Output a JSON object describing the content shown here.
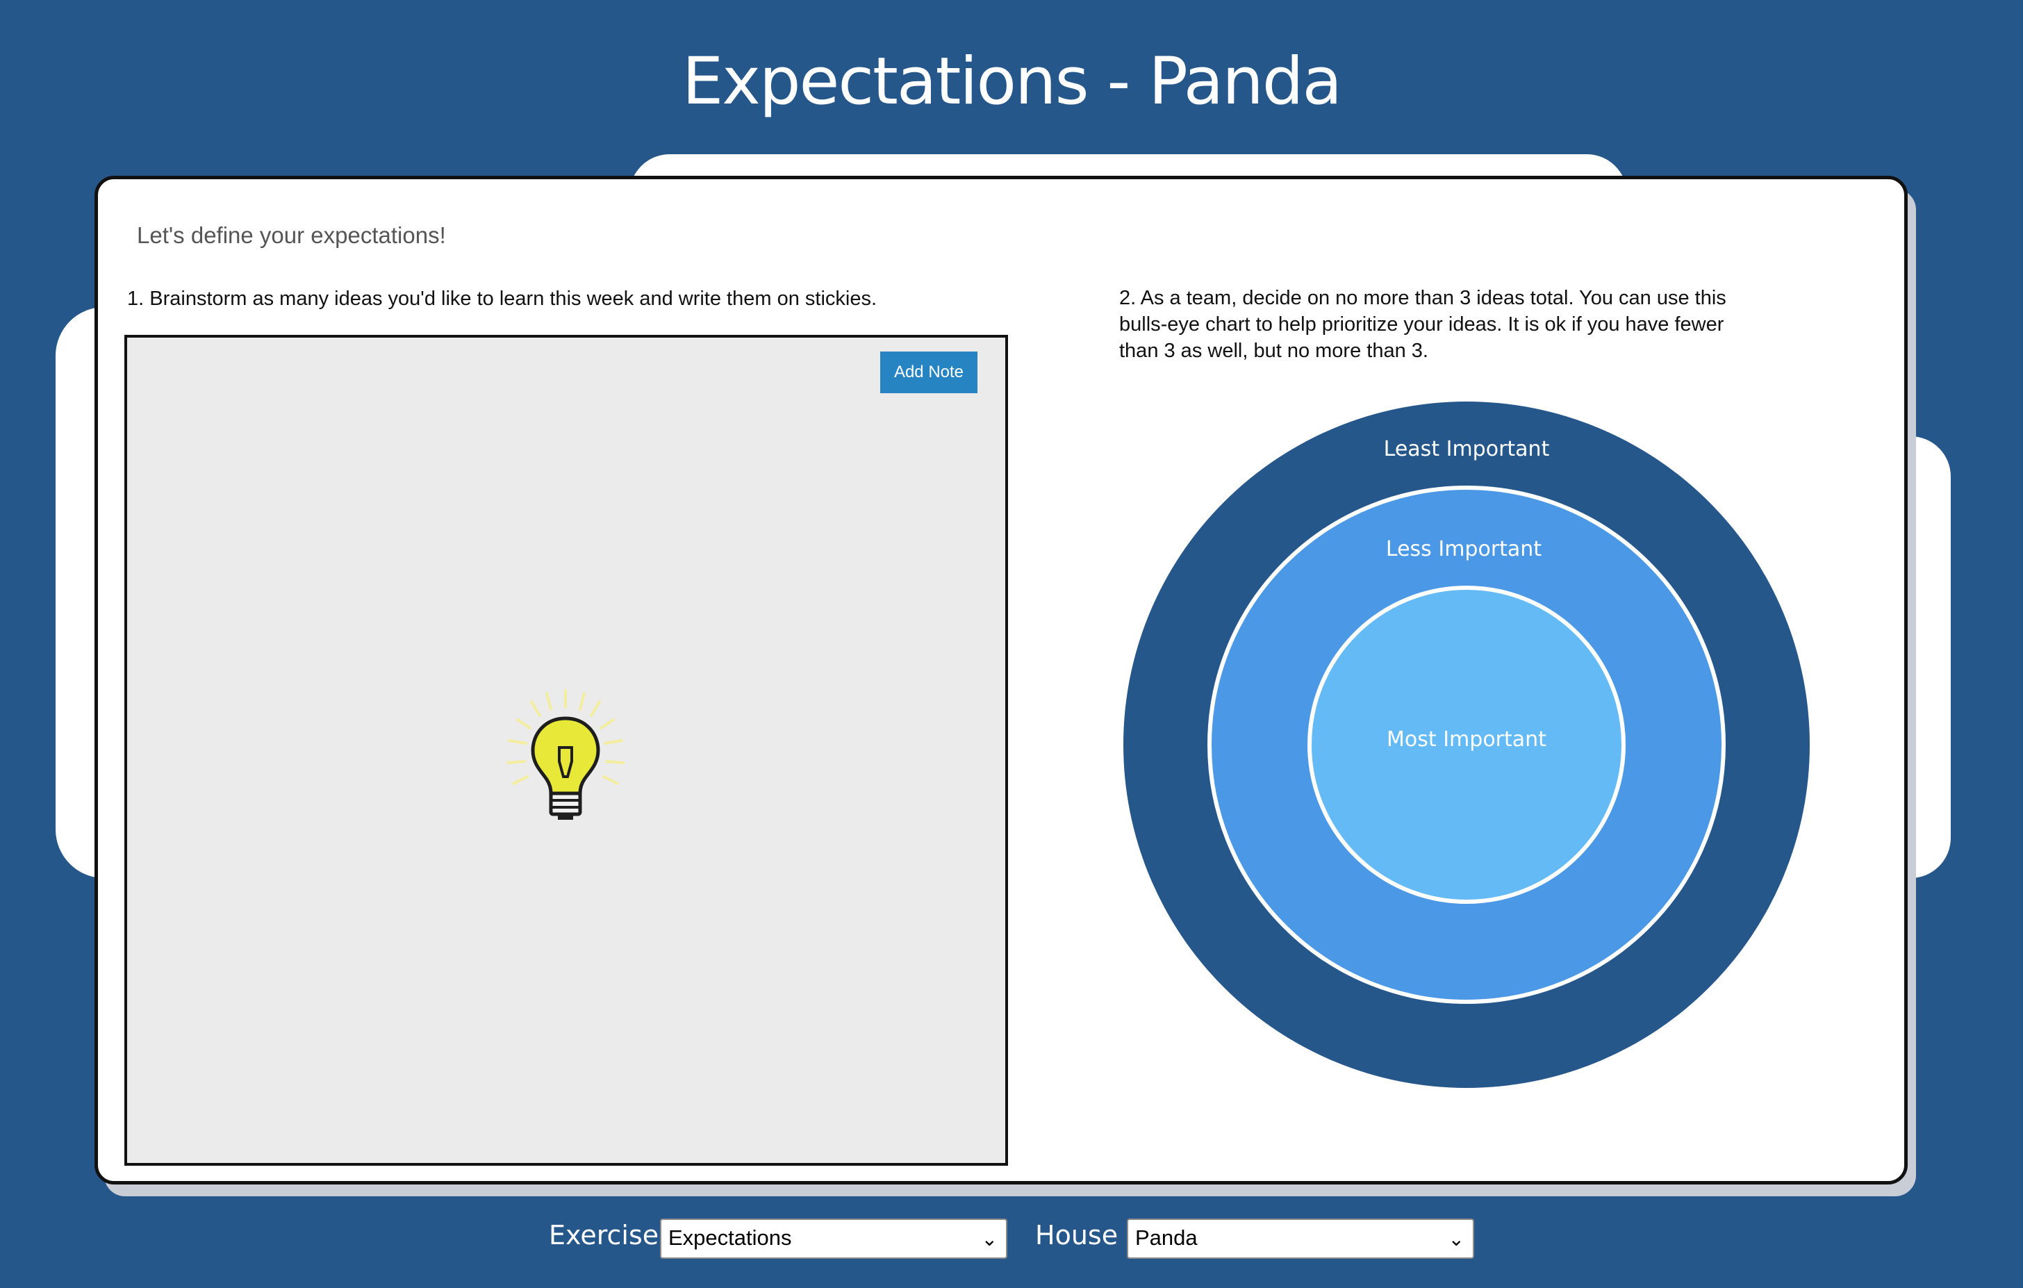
{
  "header": {
    "title": "Expectations - Panda"
  },
  "card": {
    "intro": "Let's define your expectations!",
    "step1": "1. Brainstorm as many ideas you'd like to learn this week and write them on stickies.",
    "step2": "2. As a team, decide on no more than 3 ideas total. You can use this bulls-eye chart to help prioritize your ideas. It is ok if you have fewer than 3 as well, but no more than 3.",
    "add_note_label": "Add Note",
    "bulb_icon": "lightbulb-icon"
  },
  "bullseye": {
    "outer_label": "Least Important",
    "middle_label": "Less Important",
    "inner_label": "Most Important",
    "colors": {
      "outer": "#26578b",
      "middle": "#4a98e6",
      "inner": "#64baf5"
    }
  },
  "footer": {
    "exercise_label": "Exercise",
    "exercise_value": "Expectations",
    "house_label": "House",
    "house_value": "Panda"
  },
  "theme": {
    "background": "#26578b",
    "button": "#2584c1",
    "board": "#ebebeb"
  }
}
